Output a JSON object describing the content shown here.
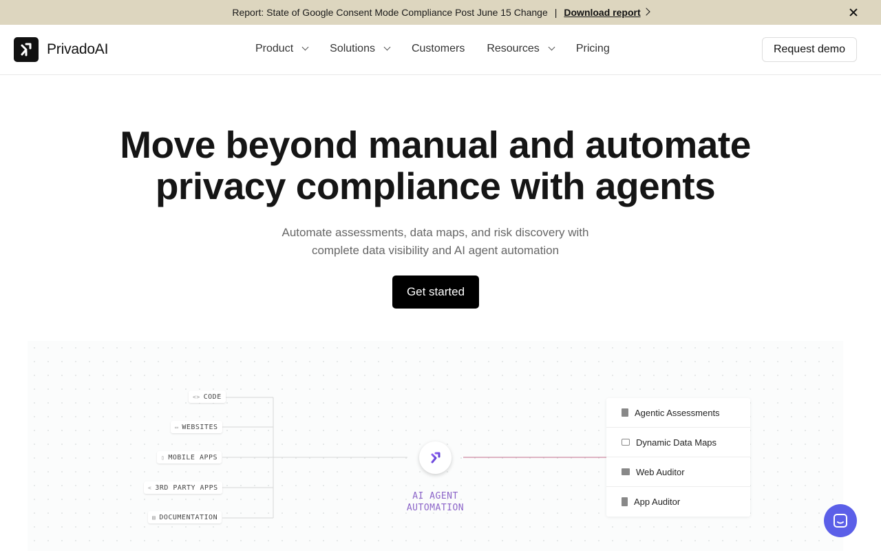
{
  "announcement": {
    "text": "Report: State of Google Consent Mode Compliance Post June 15 Change",
    "separator": "|",
    "link_label": "Download report"
  },
  "nav": {
    "logo_text": "PrivadoAI",
    "items": [
      {
        "label": "Product",
        "has_dropdown": true
      },
      {
        "label": "Solutions",
        "has_dropdown": true
      },
      {
        "label": "Customers",
        "has_dropdown": false
      },
      {
        "label": "Resources",
        "has_dropdown": true
      },
      {
        "label": "Pricing",
        "has_dropdown": false
      }
    ],
    "demo_label": "Request demo"
  },
  "hero": {
    "title_line1": "Move beyond manual and automate",
    "title_line2": "privacy compliance with agents",
    "subtitle_line1": "Automate assessments, data maps, and risk discovery with",
    "subtitle_line2": "complete data visibility and AI agent automation",
    "cta_label": "Get started"
  },
  "diagram": {
    "sources": [
      {
        "label": "CODE",
        "icon": "code-icon"
      },
      {
        "label": "WEBSITES",
        "icon": "browser-icon"
      },
      {
        "label": "MOBILE APPS",
        "icon": "phone-icon"
      },
      {
        "label": "3RD PARTY APPS",
        "icon": "share-icon"
      },
      {
        "label": "DOCUMENTATION",
        "icon": "document-icon"
      }
    ],
    "hub_line1": "AI AGENT",
    "hub_line2": "AUTOMATION",
    "outputs": [
      {
        "label": "Agentic Assessments",
        "icon": "document-icon"
      },
      {
        "label": "Dynamic Data Maps",
        "icon": "network-icon"
      },
      {
        "label": "Web Auditor",
        "icon": "browser-icon"
      },
      {
        "label": "App Auditor",
        "icon": "phone-icon"
      }
    ],
    "colors": {
      "hub_text": "#8b64c8",
      "connector": "#c06a8a"
    }
  },
  "colors": {
    "announcement_bg": "#ddd6bf",
    "chat_button": "#5b5fe8",
    "cta_bg": "#000000"
  }
}
